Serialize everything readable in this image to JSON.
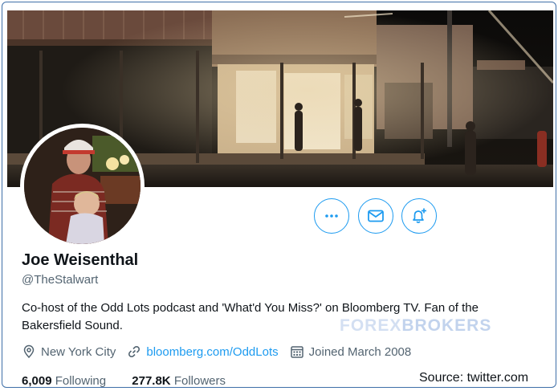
{
  "profile": {
    "name": "Joe Weisenthal",
    "handle": "@TheStalwart",
    "bio": "Co-host of the Odd Lots podcast and 'What'd You Miss?' on Bloomberg TV. Fan of the Bakersfield Sound.",
    "location": "New York City",
    "website": "bloomberg.com/OddLots",
    "joined": "Joined March 2008",
    "following_count": "6,009",
    "following_label": "Following",
    "followers_count": "277.8K",
    "followers_label": "Followers"
  },
  "actions": {
    "more_icon": "more-dots-icon",
    "message_icon": "envelope-icon",
    "notify_icon": "bell-plus-icon"
  },
  "icons": {
    "location": "location-pin-icon",
    "website": "link-icon",
    "joined": "calendar-icon"
  },
  "watermark": {
    "part1": "FOREX",
    "part2": "BROKERS"
  },
  "source": "Source: twitter.com",
  "colors": {
    "accent": "#1d9bf0",
    "text": "#0f1419",
    "secondary": "#536471",
    "frame": "#3f6fa8"
  }
}
